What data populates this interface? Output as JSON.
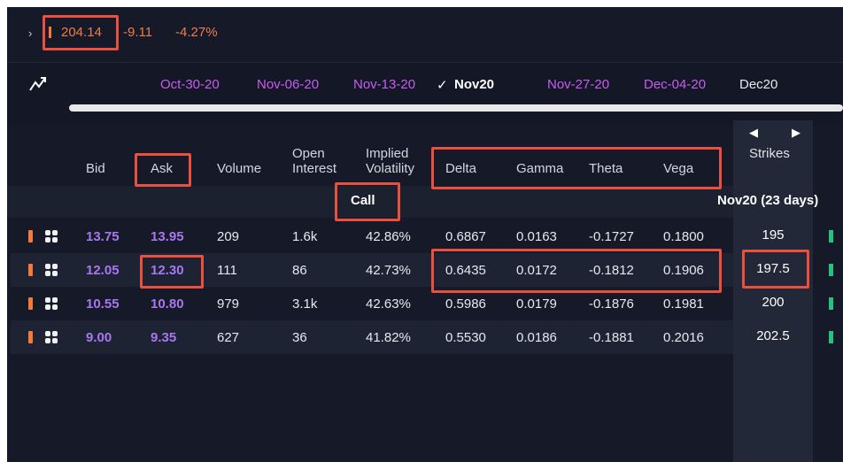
{
  "ticker": {
    "price": "204.14",
    "change": "-9.11",
    "change_pct": "-4.27%"
  },
  "expirations": {
    "items": [
      "Oct-30-20",
      "Nov-06-20",
      "Nov-13-20",
      "Nov20",
      "Nov-27-20",
      "Dec-04-20",
      "Dec20"
    ],
    "active": "Nov20"
  },
  "columns": {
    "bid": "Bid",
    "ask": "Ask",
    "volume": "Volume",
    "open_interest_1": "Open",
    "open_interest_2": "Interest",
    "implied_vol_1": "Implied",
    "implied_vol_2": "Volatility",
    "delta": "Delta",
    "gamma": "Gamma",
    "theta": "Theta",
    "vega": "Vega",
    "strikes": "Strikes"
  },
  "section": {
    "call_label": "Call",
    "expiration_label": "Nov20 (23 days)"
  },
  "rows": [
    {
      "bid": "13.75",
      "ask": "13.95",
      "volume": "209",
      "open_interest": "1.6k",
      "iv": "42.86%",
      "delta": "0.6867",
      "gamma": "0.0163",
      "theta": "-0.1727",
      "vega": "0.1800",
      "strike": "195"
    },
    {
      "bid": "12.05",
      "ask": "12.30",
      "volume": "111",
      "open_interest": "86",
      "iv": "42.73%",
      "delta": "0.6435",
      "gamma": "0.0172",
      "theta": "-0.1812",
      "vega": "0.1906",
      "strike": "197.5"
    },
    {
      "bid": "10.55",
      "ask": "10.80",
      "volume": "979",
      "open_interest": "3.1k",
      "iv": "42.63%",
      "delta": "0.5986",
      "gamma": "0.0179",
      "theta": "-0.1876",
      "vega": "0.1981",
      "strike": "200"
    },
    {
      "bid": "9.00",
      "ask": "9.35",
      "volume": "627",
      "open_interest": "36",
      "iv": "41.82%",
      "delta": "0.5530",
      "gamma": "0.0186",
      "theta": "-0.1881",
      "vega": "0.2016",
      "strike": "202.5"
    }
  ],
  "colors": {
    "accent_orange": "#f07b4b",
    "date_purple": "#c85cf0",
    "bid_ask_purple": "#a777f2",
    "annotation_red": "#e9513e",
    "green_indicator": "#26c281"
  },
  "icons": {
    "chevron": "chevron-right-icon",
    "chart": "line-chart-icon",
    "left_arrow": "triangle-left-icon",
    "right_arrow": "triangle-right-icon",
    "grid": "grid-icon"
  }
}
